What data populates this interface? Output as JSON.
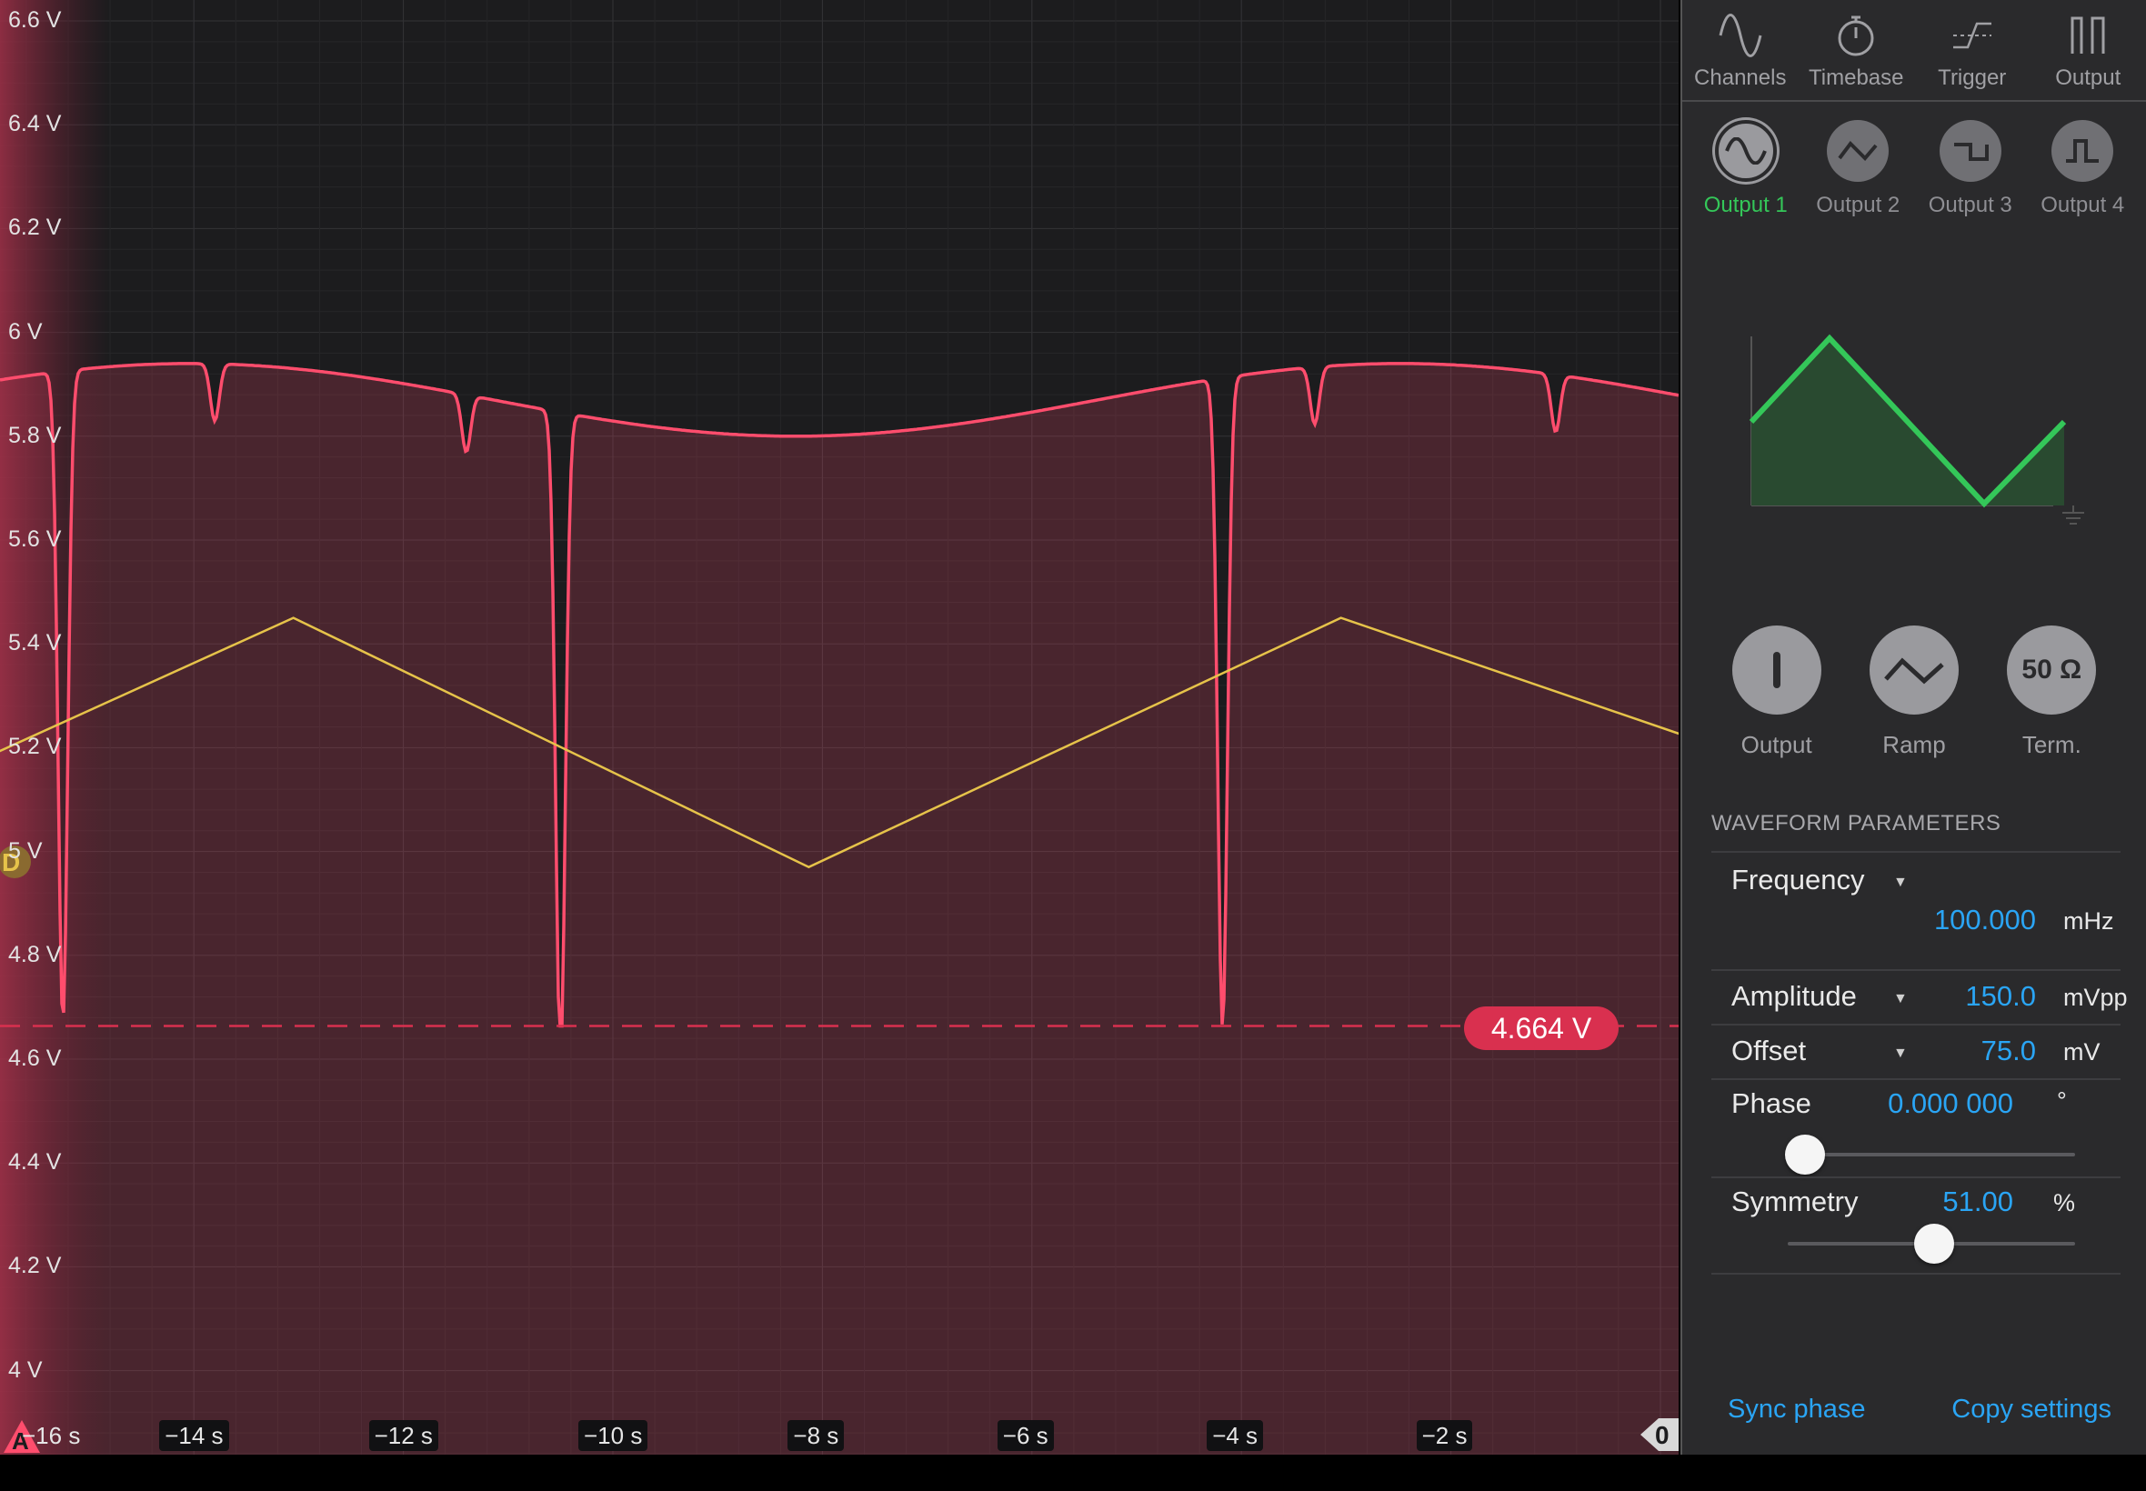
{
  "plot": {
    "y_axis_labels": [
      "6.6 V",
      "6.4 V",
      "6.2 V",
      "6 V",
      "5.8 V",
      "5.6 V",
      "5.4 V",
      "5.2 V",
      "5 V",
      "4.8 V",
      "4.6 V",
      "4.4 V",
      "4.2 V",
      "4 V"
    ],
    "x_axis_labels": [
      "−16 s",
      "−14 s",
      "−12 s",
      "−10 s",
      "−8 s",
      "−6 s",
      "−4 s",
      "−2 s"
    ],
    "cursor_value": "4.664 V",
    "channel_a_marker": "A",
    "channel_d_marker": "D",
    "zero_marker": "0",
    "colors": {
      "channel_a": "#ff4d6d",
      "channel_d": "#e6c34a",
      "cursor": "#d9304f"
    }
  },
  "panel": {
    "tabs": [
      {
        "label": "Channels",
        "icon": "sine-wave-icon"
      },
      {
        "label": "Timebase",
        "icon": "stopwatch-icon"
      },
      {
        "label": "Trigger",
        "icon": "trigger-edge-icon"
      },
      {
        "label": "Output",
        "icon": "pulse-output-icon"
      }
    ],
    "outputs": [
      {
        "label": "Output 1",
        "icon": "sine-wave-icon",
        "active": true
      },
      {
        "label": "Output 2",
        "icon": "ramp-wave-icon",
        "active": false
      },
      {
        "label": "Output 3",
        "icon": "square-wave-icon",
        "active": false
      },
      {
        "label": "Output 4",
        "icon": "pulse-wave-icon",
        "active": false
      }
    ],
    "controls": [
      {
        "label": "Output",
        "icon": "power-toggle-icon"
      },
      {
        "label": "Ramp",
        "icon": "ramp-wave-icon"
      },
      {
        "label": "Term.",
        "text": "50 Ω"
      }
    ],
    "section_title": "WAVEFORM PARAMETERS",
    "frequency": {
      "label": "Frequency",
      "value": "100.000",
      "unit": "mHz"
    },
    "amplitude": {
      "label": "Amplitude",
      "value": "150.0",
      "unit": "mVpp"
    },
    "offset": {
      "label": "Offset",
      "value": "75.0",
      "unit": "mV"
    },
    "phase": {
      "label": "Phase",
      "value": "0.000 000",
      "unit": "°",
      "slider_fraction": 0.06
    },
    "symmetry": {
      "label": "Symmetry",
      "value": "51.00",
      "unit": "%",
      "slider_fraction": 0.51
    },
    "sync_phase": "Sync phase",
    "copy_settings": "Copy settings",
    "accent": "#34c759",
    "link_color": "#2aa5f5"
  }
}
